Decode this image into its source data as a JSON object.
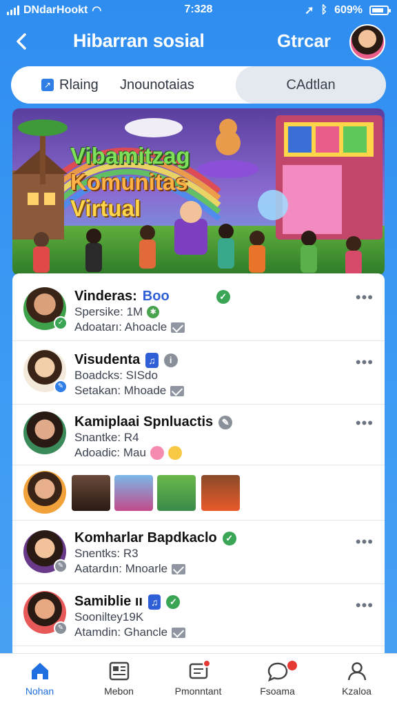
{
  "status_bar": {
    "carrier": "DNdarHookt",
    "time": "7:328",
    "battery": "609%"
  },
  "header": {
    "title": "Hibarran sosial",
    "action": "Gtrcar"
  },
  "tabs": [
    {
      "label": "Rlaing"
    },
    {
      "label": "Jnounotaias"
    },
    {
      "label": "CAdtlan"
    }
  ],
  "banner": {
    "line1": "Vibamitzag",
    "line2": "Komunitas",
    "line3": "Virtual"
  },
  "items": [
    {
      "name": "Vinderas:",
      "name_tag": "Boo",
      "line1": "Spersike: 1M",
      "line2": "Adoatarı: Ahoacle"
    },
    {
      "name": "Visudenta",
      "line1": "Boadcks: SISdo",
      "line2": "Setakan: Mhoade"
    },
    {
      "name": "Kamiplaai Spnluactis",
      "line1": "Snantke: R4",
      "line2": "Adoadic: Mau"
    },
    {
      "name": "Komharlar Bapdkaclo",
      "line1": "Snentks: R3",
      "line2": "Aatardın: Mnoarle"
    },
    {
      "name": "Samiblie ıı",
      "line1": "Sooniltey19K",
      "line2": "Atamdin: Ghancle"
    }
  ],
  "nav": [
    {
      "label": "Nohan",
      "icon": "home-icon"
    },
    {
      "label": "Mebon",
      "icon": "news-icon"
    },
    {
      "label": "Pmonntant",
      "icon": "notification-icon"
    },
    {
      "label": "Fsoama",
      "icon": "chat-icon"
    },
    {
      "label": "Kzaloa",
      "icon": "profile-icon"
    }
  ],
  "colors": {
    "brand_blue": "#2f8df0",
    "verified_green": "#3aa655",
    "active_nav": "#1f6fe0"
  }
}
